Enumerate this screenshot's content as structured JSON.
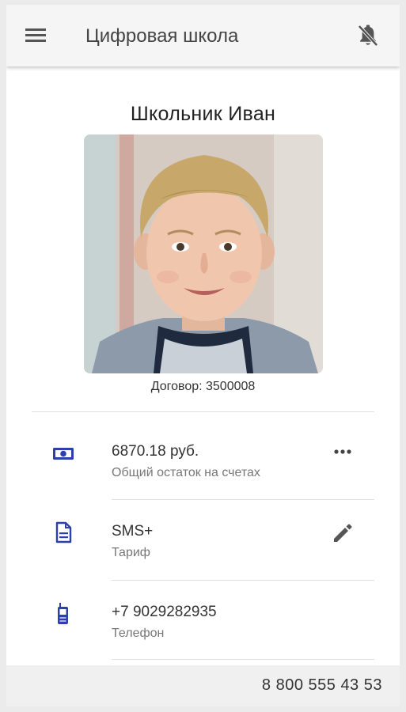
{
  "header": {
    "title": "Цифровая школа"
  },
  "student": {
    "name": "Школьник Иван",
    "contract": "Договор: 3500008"
  },
  "info_items": [
    {
      "value": "6870.18 руб.",
      "label": "Общий остаток на счетах",
      "icon": "money-icon",
      "action": "more-icon"
    },
    {
      "value": "SMS+",
      "label": "Тариф",
      "icon": "document-icon",
      "action": "edit-icon"
    },
    {
      "value": "+7 9029282935",
      "label": "Телефон",
      "icon": "phone-icon"
    }
  ],
  "footer": {
    "phone": "8 800 555 43 53"
  },
  "colors": {
    "accent": "#2d3fa8",
    "appbar": "#f5f5f5",
    "footer": "#f0f0f0"
  }
}
